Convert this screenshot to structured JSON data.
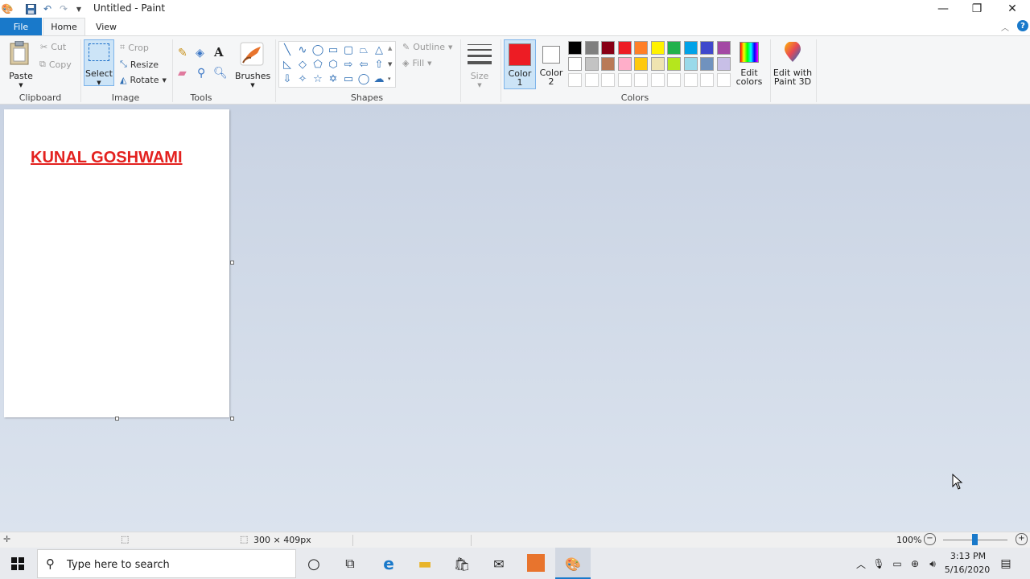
{
  "window": {
    "title": "Untitled - Paint",
    "minimize_icon": "minimize-icon",
    "maximize_icon": "restore-icon",
    "close_icon": "close-icon"
  },
  "tabs": {
    "file": "File",
    "home": "Home",
    "view": "View"
  },
  "ribbon": {
    "clipboard": {
      "label": "Clipboard",
      "paste": "Paste",
      "cut": "Cut",
      "copy": "Copy"
    },
    "image": {
      "label": "Image",
      "select": "Select",
      "crop": "Crop",
      "resize": "Resize",
      "rotate": "Rotate"
    },
    "tools": {
      "label": "Tools"
    },
    "brushes": {
      "label": "Brushes"
    },
    "shapes": {
      "label": "Shapes",
      "outline": "Outline",
      "fill": "Fill"
    },
    "size": {
      "label": "Size"
    },
    "colors": {
      "label": "Colors",
      "color1_l1": "Color",
      "color1_l2": "1",
      "color2_l1": "Color",
      "color2_l2": "2",
      "edit_l1": "Edit",
      "edit_l2": "colors",
      "paint3d_l1": "Edit with",
      "paint3d_l2": "Paint 3D",
      "color1_value": "#ed1c24",
      "color2_value": "#ffffff",
      "palette_row1": [
        "#000000",
        "#7f7f7f",
        "#880015",
        "#ed1c24",
        "#ff7f27",
        "#fff200",
        "#22b14c",
        "#00a2e8",
        "#3f48cc",
        "#a349a4"
      ],
      "palette_row2": [
        "#ffffff",
        "#c3c3c3",
        "#b97a57",
        "#ffaec9",
        "#ffc90e",
        "#efe4b0",
        "#b5e61d",
        "#99d9ea",
        "#7092be",
        "#c8bfe7"
      ]
    }
  },
  "canvas": {
    "text": "KUNAL GOSHWAMI",
    "text_color": "#e3211f"
  },
  "status": {
    "dimensions": "300 × 409px",
    "zoom": "100%"
  },
  "taskbar": {
    "search_placeholder": "Type here to search",
    "time": "3:13 PM",
    "date": "5/16/2020"
  }
}
